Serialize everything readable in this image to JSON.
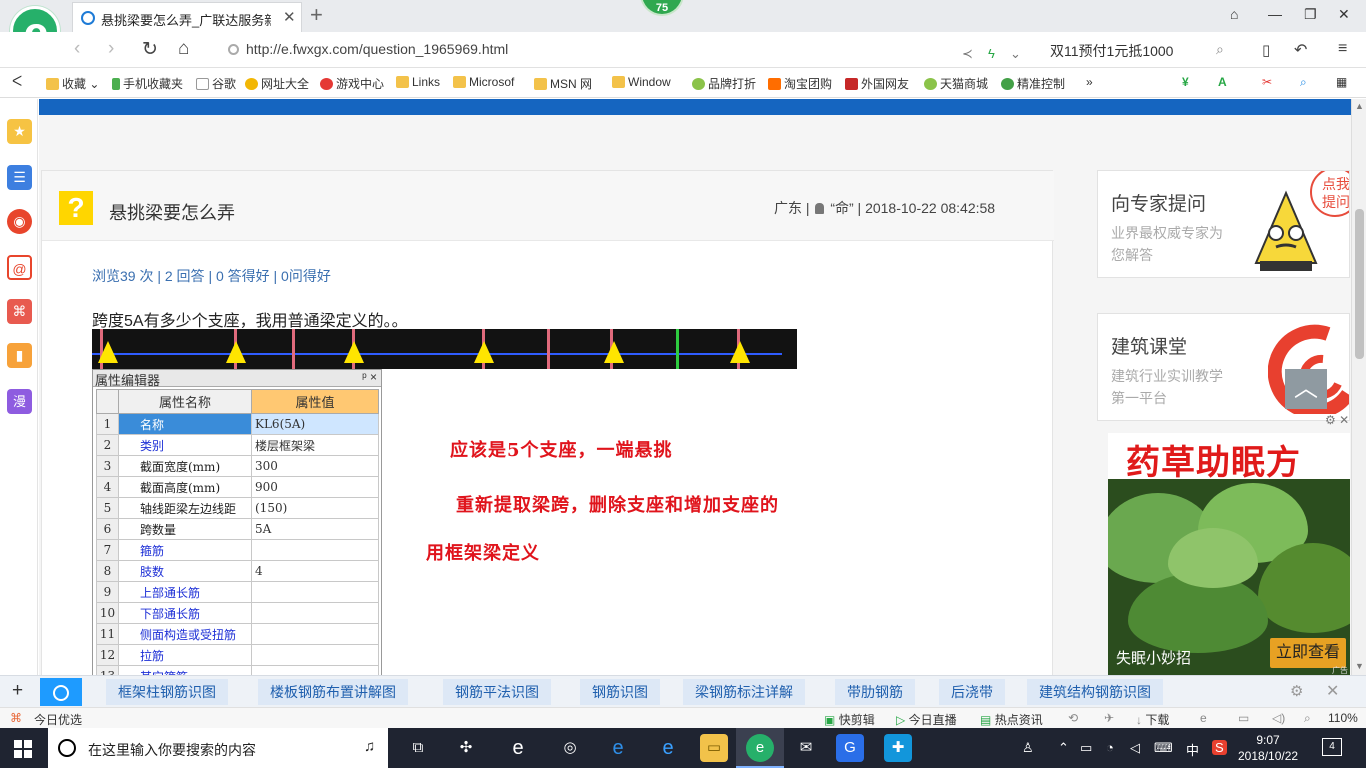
{
  "browser": {
    "tab_title": "悬挑梁要怎么弄_广联达服务新干线",
    "badge": "75",
    "url": "http://e.fwxgx.com/question_1965969.html",
    "search_text": "双11预付1元抵1000"
  },
  "bookmarks": [
    "收藏",
    "手机收藏夹",
    "谷歌",
    "网址大全",
    "游戏中心",
    "Links",
    "Microsof",
    "MSN 网",
    "Window",
    "品牌打折",
    "淘宝团购",
    "外国网友",
    "天猫商城",
    "精准控制"
  ],
  "question": {
    "title": "悬挑梁要怎么弄",
    "location": "广东",
    "user": "“命”",
    "datetime": "2018-10-22 08:42:58",
    "stats": "浏览39 次 | 2 回答 | 0 答得好 | 0问得好",
    "body": "跨度5A有多少个支座，我用普通梁定义的。。"
  },
  "property_editor": {
    "title": "属性编辑器",
    "pin": "ᵖ",
    "close": "×",
    "col_name": "属性名称",
    "col_value": "属性值",
    "rows": [
      {
        "n": "1",
        "name": "名称",
        "value": "KL6(5A)"
      },
      {
        "n": "2",
        "name": "类别",
        "value": "楼层框架梁"
      },
      {
        "n": "3",
        "name": "截面宽度(mm)",
        "value": "300"
      },
      {
        "n": "4",
        "name": "截面高度(mm)",
        "value": "900"
      },
      {
        "n": "5",
        "name": "轴线距梁左边线距",
        "value": "(150)"
      },
      {
        "n": "6",
        "name": "跨数量",
        "value": "5A"
      },
      {
        "n": "7",
        "name": "箍筋",
        "value": ""
      },
      {
        "n": "8",
        "name": "肢数",
        "value": "4"
      },
      {
        "n": "9",
        "name": "上部通长筋",
        "value": ""
      },
      {
        "n": "10",
        "name": "下部通长筋",
        "value": ""
      },
      {
        "n": "11",
        "name": "侧面构造或受扭筋",
        "value": ""
      },
      {
        "n": "12",
        "name": "拉筋",
        "value": ""
      },
      {
        "n": "13",
        "name": "其它箍筋",
        "value": ""
      }
    ]
  },
  "annotations": {
    "line1": "应该是5个支座，一端悬挑",
    "line2": "重新提取梁跨，删除支座和增加支座的",
    "line3": "用框架梁定义"
  },
  "side": {
    "expert_title": "向专家提问",
    "expert_sub": "业界最权威专家为您解答",
    "expert_bubble": "点我提问",
    "class_title": "建筑课堂",
    "class_sub": "建筑行业实训教学第一平台",
    "back_top": "︿"
  },
  "ad": {
    "title": "药草助眠方",
    "caption": "失眠小妙招",
    "button": "立即查看",
    "mark": "广告"
  },
  "tags": [
    "框架柱钢筋识图",
    "楼板钢筋布置讲解图",
    "钢筋平法识图",
    "钢筋识图",
    "梁钢筋标注详解",
    "带肋钢筋",
    "后浇带",
    "建筑结构钢筋识图"
  ],
  "status": {
    "today": "今日优选",
    "items": [
      "快剪辑",
      "今日直播",
      "热点资讯",
      "下载"
    ],
    "zoom": "110%"
  },
  "taskbar": {
    "search_placeholder": "在这里输入你要搜索的内容",
    "ime": "中",
    "time": "9:07",
    "date": "2018/10/22",
    "notifications": "4"
  }
}
